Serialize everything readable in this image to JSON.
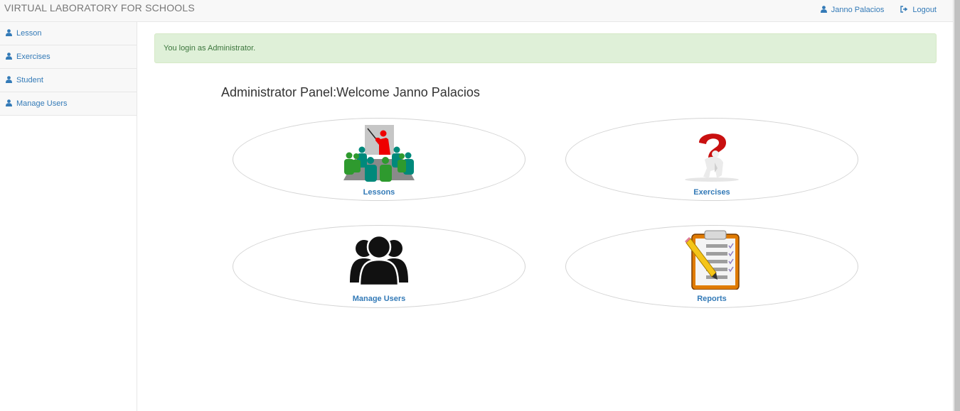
{
  "navbar": {
    "brand": "VIRTUAL LABORATORY FOR SCHOOLS",
    "user_label": "Janno Palacios",
    "user_icon": "user-icon",
    "logout_label": "Logout",
    "logout_icon": "sign-out-icon"
  },
  "sidebar": {
    "items": [
      {
        "label": "Lesson",
        "icon": "user-icon"
      },
      {
        "label": "Exercises",
        "icon": "user-icon"
      },
      {
        "label": "Student",
        "icon": "user-icon"
      },
      {
        "label": "Manage Users",
        "icon": "user-icon"
      }
    ]
  },
  "alert": {
    "message": "You login as Administrator."
  },
  "main": {
    "title": "Administrator Panel:Welcome Janno Palacios",
    "tiles": [
      {
        "label": "Lessons",
        "icon": "classroom-icon"
      },
      {
        "label": "Exercises",
        "icon": "question-mark-icon"
      },
      {
        "label": "Manage Users",
        "icon": "users-group-icon"
      },
      {
        "label": "Reports",
        "icon": "clipboard-icon"
      }
    ]
  },
  "colors": {
    "link": "#337ab7",
    "alert_bg": "#dff0d8",
    "alert_text": "#3c763d",
    "navbar_bg": "#f8f8f8"
  }
}
